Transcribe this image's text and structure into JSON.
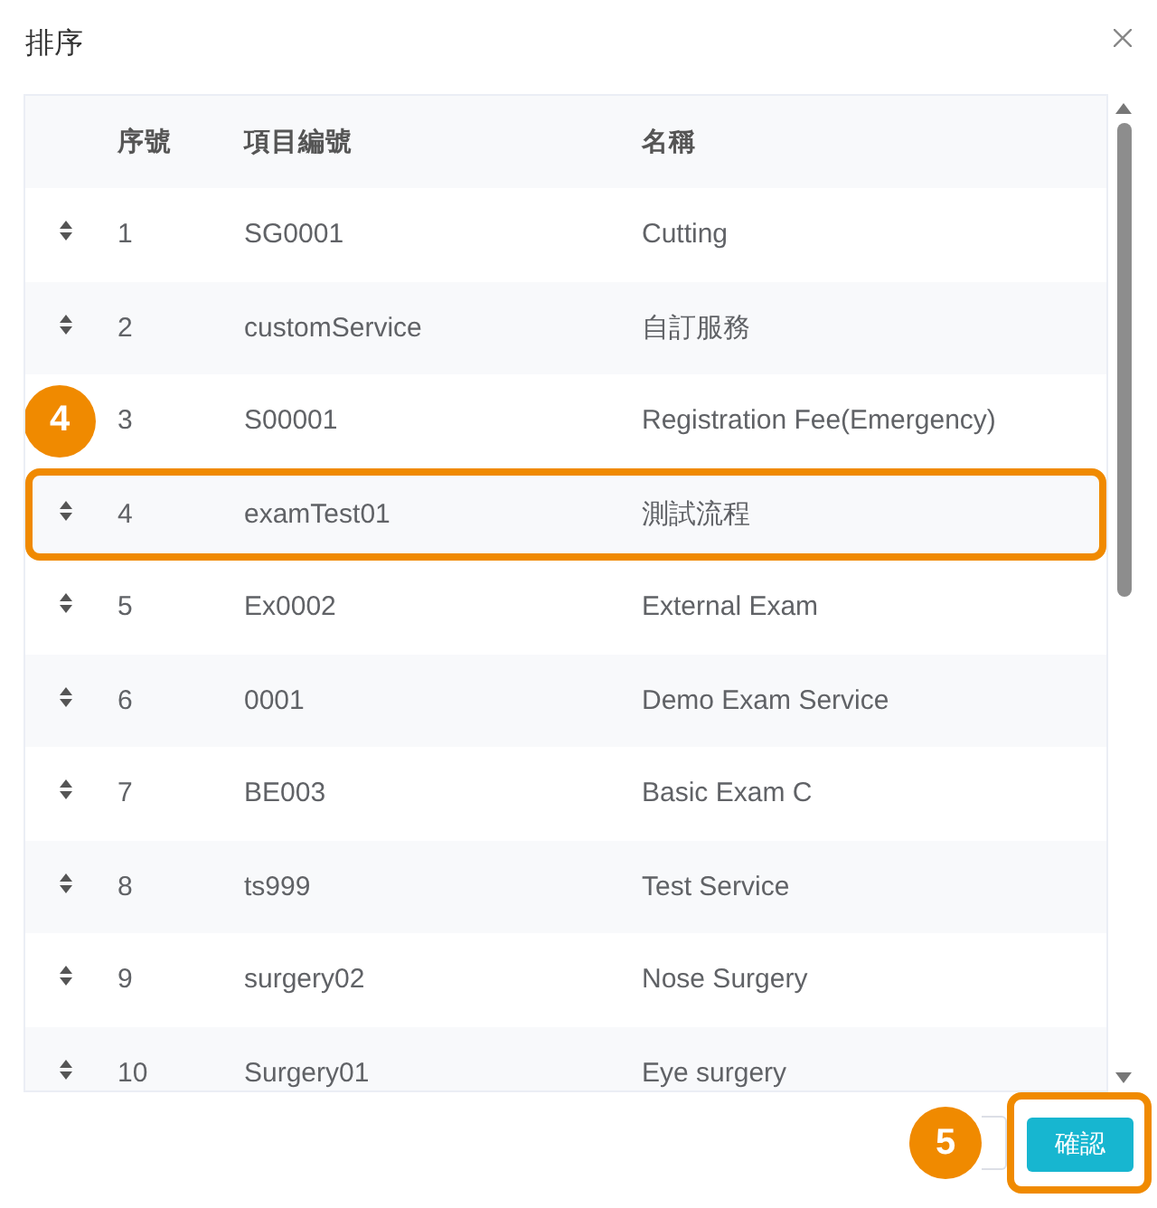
{
  "dialog": {
    "title": "排序",
    "table": {
      "columns": [
        {
          "label": "序號"
        },
        {
          "label": "項目編號"
        },
        {
          "label": "名稱"
        }
      ],
      "rows": [
        {
          "index": "1",
          "code": "SG0001",
          "name": "Cutting",
          "outlined": false
        },
        {
          "index": "2",
          "code": "customService",
          "name": "自訂服務",
          "outlined": false
        },
        {
          "index": "3",
          "code": "S00001",
          "name": "Registration Fee(Emergency)",
          "outlined": false,
          "callout": "4"
        },
        {
          "index": "4",
          "code": "examTest01",
          "name": "測試流程",
          "outlined": true
        },
        {
          "index": "5",
          "code": "Ex0002",
          "name": "External Exam",
          "outlined": false
        },
        {
          "index": "6",
          "code": "0001",
          "name": "Demo Exam Service",
          "outlined": false
        },
        {
          "index": "7",
          "code": "BE003",
          "name": "Basic Exam C",
          "outlined": false
        },
        {
          "index": "8",
          "code": "ts999",
          "name": "Test Service",
          "outlined": false
        },
        {
          "index": "9",
          "code": "surgery02",
          "name": "Nose Surgery",
          "outlined": false
        },
        {
          "index": "10",
          "code": "Surgery01",
          "name": "Eye surgery",
          "outlined": false
        }
      ]
    },
    "footer": {
      "buttons": [
        {
          "kind": "secondary",
          "outlined": false,
          "callout": "5"
        },
        {
          "kind": "primary",
          "label": "確認",
          "outlined": true
        }
      ]
    }
  }
}
